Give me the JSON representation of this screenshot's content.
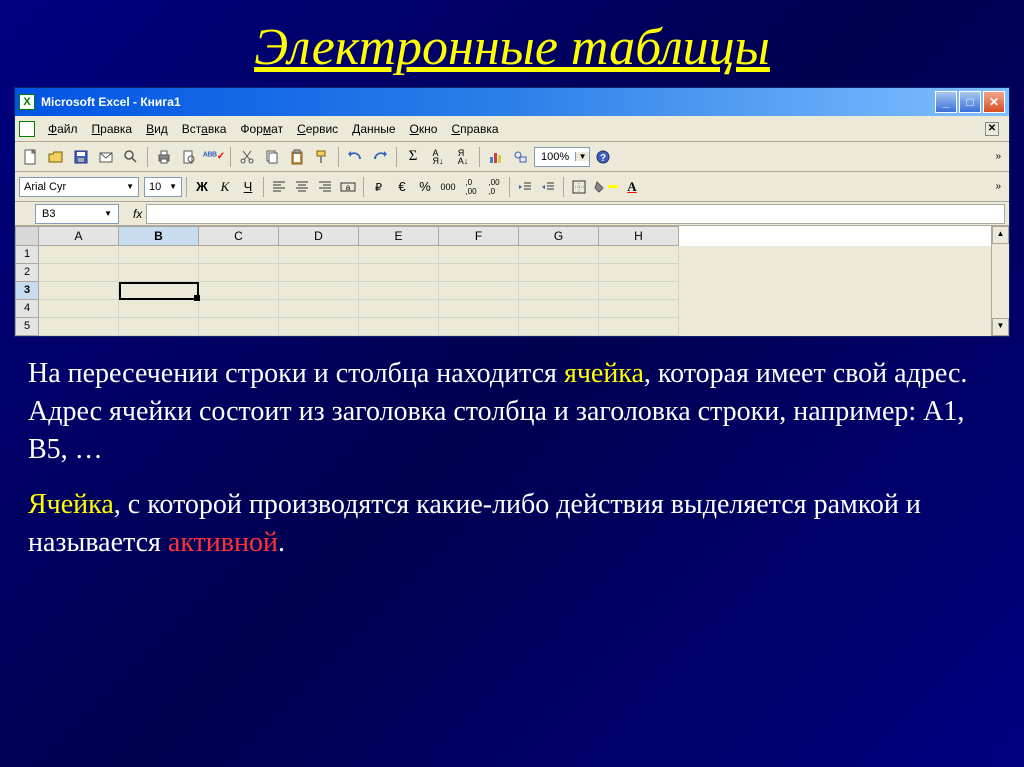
{
  "slide": {
    "title": "Электронные таблицы"
  },
  "titlebar": {
    "text": "Microsoft Excel - Книга1"
  },
  "menus": {
    "file": "Файл",
    "edit": "Правка",
    "view": "Вид",
    "insert": "Вставка",
    "format": "Формат",
    "tools": "Сервис",
    "data": "Данные",
    "window": "Окно",
    "help": "Справка"
  },
  "format": {
    "font_name": "Arial Cyr",
    "font_size": "10"
  },
  "zoom": {
    "value": "100%"
  },
  "namebox": {
    "value": "B3"
  },
  "columns": [
    "A",
    "B",
    "C",
    "D",
    "E",
    "F",
    "G",
    "H"
  ],
  "rows": [
    "1",
    "2",
    "3",
    "4",
    "5"
  ],
  "text": {
    "p1a": "На пересечении строки и столбца находится ",
    "p1_y": "ячейка",
    "p1b": ", которая имеет свой адрес. Адрес ячейки состоит из заголовка столбца  и заголовка строки, например: А1, В5, …",
    "p2_y": "Ячейка",
    "p2a": ",  с которой производятся какие-либо действия выделяется рамкой и называется ",
    "p2_r": "активной",
    "p2b": "."
  }
}
